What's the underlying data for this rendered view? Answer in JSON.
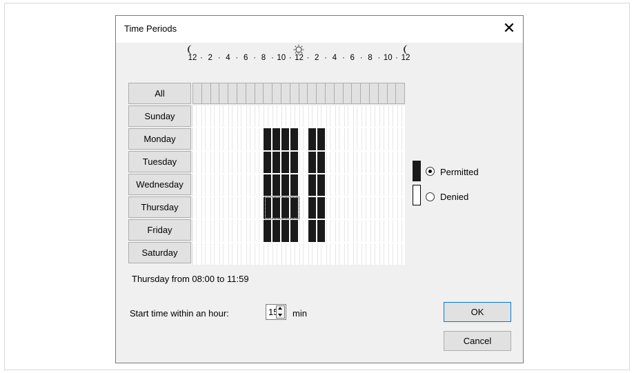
{
  "dialog": {
    "title": "Time Periods",
    "close_label": "✕"
  },
  "hour_labels": [
    "12",
    "2",
    "4",
    "6",
    "8",
    "10",
    "12",
    "2",
    "4",
    "6",
    "8",
    "10",
    "12"
  ],
  "icons": {
    "start": "moon-icon",
    "middle": "sun-icon",
    "end": "moon-icon"
  },
  "days": {
    "all_label": "All",
    "rows": [
      {
        "label": "Sunday",
        "permitted_hours": []
      },
      {
        "label": "Monday",
        "permitted_hours": [
          8,
          9,
          10,
          11,
          13,
          14
        ]
      },
      {
        "label": "Tuesday",
        "permitted_hours": [
          8,
          9,
          10,
          11,
          13,
          14
        ]
      },
      {
        "label": "Wednesday",
        "permitted_hours": [
          8,
          9,
          10,
          11,
          13,
          14
        ]
      },
      {
        "label": "Thursday",
        "permitted_hours": [
          8,
          9,
          10,
          11,
          13,
          14
        ]
      },
      {
        "label": "Friday",
        "permitted_hours": [
          8,
          9,
          10,
          11,
          13,
          14
        ]
      },
      {
        "label": "Saturday",
        "permitted_hours": []
      }
    ]
  },
  "selection_status": "Thursday from 08:00 to 11:59",
  "legend": {
    "permitted_label": "Permitted",
    "denied_label": "Denied",
    "selected": "permitted"
  },
  "start_time": {
    "label": "Start time within an hour:",
    "value": "15",
    "unit": "min"
  },
  "buttons": {
    "ok": "OK",
    "cancel": "Cancel"
  },
  "colors": {
    "permitted": "#1a1a1a",
    "denied": "#ffffff",
    "dialog_bg": "#f0f0f0"
  }
}
